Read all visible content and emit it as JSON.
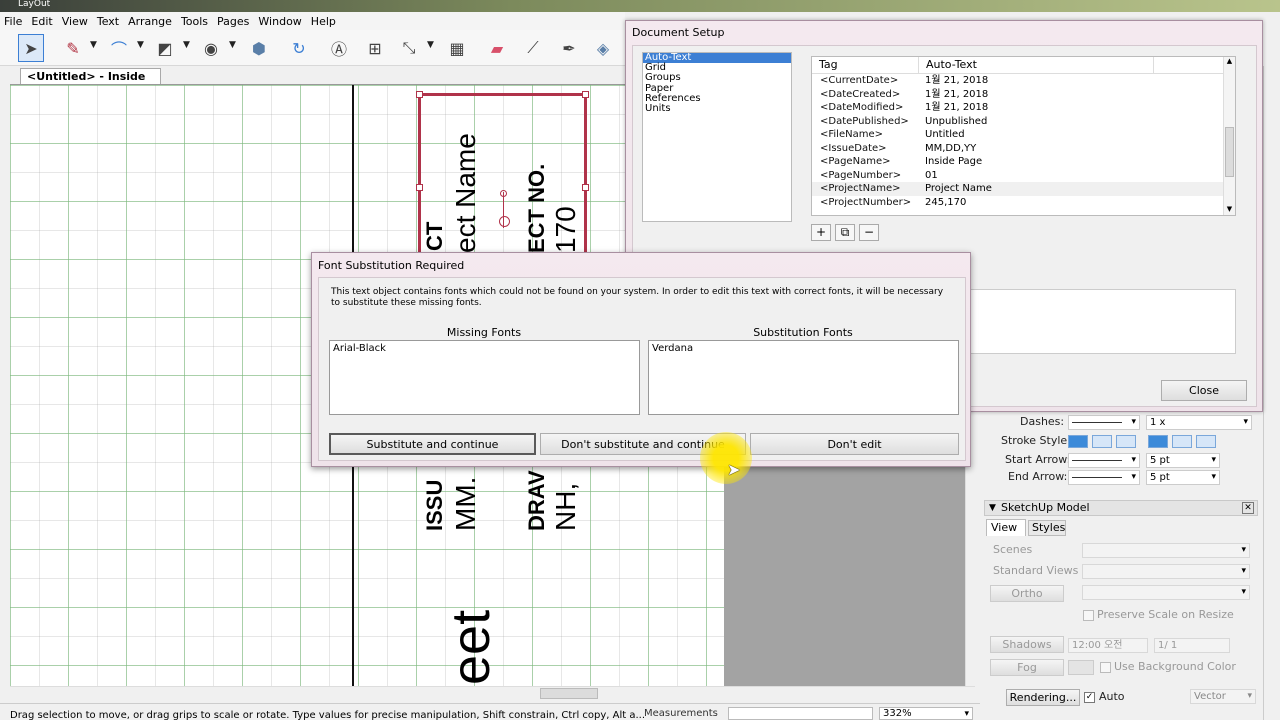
{
  "window": {
    "title": "LayOut"
  },
  "menu": [
    "File",
    "Edit",
    "View",
    "Text",
    "Arrange",
    "Tools",
    "Pages",
    "Window",
    "Help"
  ],
  "document_tab": {
    "label": "<Untitled> - Inside Page"
  },
  "canvas_texts": {
    "project_name": "ect Name",
    "project_label": "CT",
    "project_no_label": "ECT NO.",
    "project_no_value": "170",
    "issue_label": "ISSU",
    "issue_value": "MM.",
    "drawn_label": "DRAV",
    "drawn_value": "NH,",
    "sheet_text": "eet"
  },
  "status": {
    "hint": "Drag selection to move, or drag grips to scale or rotate. Type values for precise manipulation, Shift constrain, Ctrl copy, Alt a...",
    "measurements_label": "Measurements",
    "zoom": "332%"
  },
  "document_setup": {
    "title": "Document Setup",
    "sections": [
      "Auto-Text",
      "Grid",
      "Groups",
      "Paper",
      "References",
      "Units"
    ],
    "selected_section": "Auto-Text",
    "columns": [
      "Tag",
      "Auto-Text"
    ],
    "rows": [
      {
        "tag": "<CurrentDate>",
        "value": "1월 21, 2018"
      },
      {
        "tag": "<DateCreated>",
        "value": "1월 21, 2018"
      },
      {
        "tag": "<DateModified>",
        "value": "1월 21, 2018"
      },
      {
        "tag": "<DatePublished>",
        "value": "Unpublished"
      },
      {
        "tag": "<FileName>",
        "value": "Untitled"
      },
      {
        "tag": "<IssueDate>",
        "value": "MM,DD,YY"
      },
      {
        "tag": "<PageName>",
        "value": "Inside Page"
      },
      {
        "tag": "<PageNumber>",
        "value": "01"
      },
      {
        "tag": "<ProjectName>",
        "value": "Project Name"
      },
      {
        "tag": "<ProjectNumber>",
        "value": "245,170"
      }
    ],
    "tool_icons": [
      "plus-icon",
      "duplicate-icon",
      "minus-icon"
    ],
    "close_label": "Close"
  },
  "font_dialog": {
    "title": "Font Substitution Required",
    "message": "This text object contains fonts which could not be found on your system.  In order to edit this text with correct fonts, it will be necessary to substitute these missing fonts.",
    "missing_header": "Missing Fonts",
    "substitution_header": "Substitution Fonts",
    "missing_fonts": [
      "Arial-Black"
    ],
    "substitution_fonts": [
      "Verdana"
    ],
    "btn_substitute": "Substitute and continue",
    "btn_dont_substitute": "Don't substitute and continue",
    "btn_dont_edit": "Don't edit"
  },
  "shape_style": {
    "dashes_label": "Dashes:",
    "dash_scale": "1 x",
    "stroke_style_label": "Stroke Style:",
    "start_arrow_label": "Start Arrow:",
    "start_arrow_size": "5 pt",
    "end_arrow_label": "End Arrow:",
    "end_arrow_size": "5 pt"
  },
  "sketchup_model": {
    "title": "SketchUp Model",
    "tabs": [
      "View",
      "Styles"
    ],
    "scenes_label": "Scenes",
    "standard_views_label": "Standard Views",
    "ortho_label": "Ortho",
    "preserve_scale_label": "Preserve Scale on Resize",
    "shadows_label": "Shadows",
    "shadow_time": "12:00 오전",
    "shadow_date": "1/ 1",
    "fog_label": "Fog",
    "use_bg_label": "Use Background Color",
    "rendering_label": "Rendering...",
    "auto_label": "Auto",
    "render_mode": "Vector"
  },
  "colors": {
    "accent": "#3c7fd4",
    "frame": "#b0334a",
    "dialog_bg": "#f2e6ed"
  }
}
